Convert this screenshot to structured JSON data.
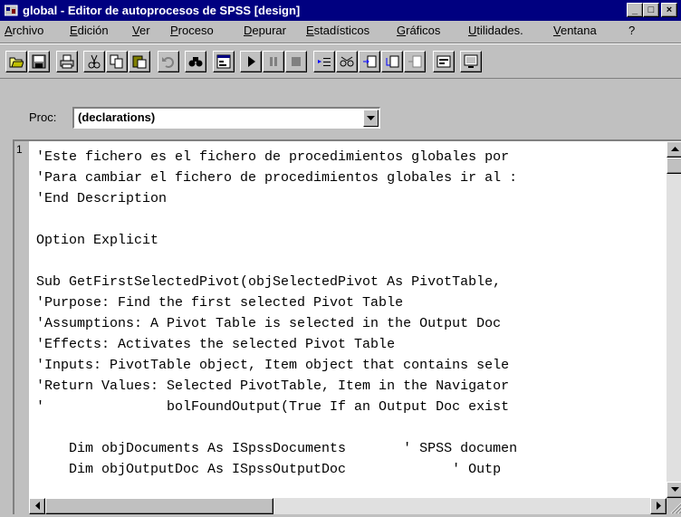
{
  "window": {
    "title": "global - Editor de autoprocesos de SPSS [design]",
    "minimize": "_",
    "maximize": "□",
    "close": "×"
  },
  "menu": {
    "items": [
      "Archivo",
      "Edición",
      "Ver",
      "Proceso",
      "Depurar",
      "Estadísticos",
      "Gráficos",
      "Utilidades.",
      "Ventana",
      "?"
    ]
  },
  "toolbar": {
    "buttons": [
      "open-icon",
      "save-icon",
      "print-icon",
      "cut-icon",
      "copy-icon",
      "paste-icon",
      "undo-icon",
      "find-icon",
      "dialog-icon",
      "run-icon",
      "pause-icon",
      "stop-icon",
      "step-icon",
      "watch-icon",
      "step-into-icon",
      "step-over-icon",
      "breakpoint-icon",
      "dialog-editor-icon",
      "screen-icon"
    ]
  },
  "proc": {
    "label": "Proc:",
    "value": "(declarations)"
  },
  "editor": {
    "line_number": "1",
    "lines": [
      "'Este fichero es el fichero de procedimientos globales por",
      "'Para cambiar el fichero de procedimientos globales ir al :",
      "'End Description",
      "",
      "Option Explicit",
      "",
      "Sub GetFirstSelectedPivot(objSelectedPivot As PivotTable,",
      "'Purpose: Find the first selected Pivot Table",
      "'Assumptions: A Pivot Table is selected in the Output Doc",
      "'Effects: Activates the selected Pivot Table",
      "'Inputs: PivotTable object, Item object that contains sele",
      "'Return Values: Selected PivotTable, Item in the Navigator",
      "'               bolFoundOutput(True If an Output Doc exist",
      "",
      "    Dim objDocuments As ISpssDocuments       ' SPSS documen",
      "    Dim objOutputDoc As ISpssOutputDoc             ' Outp"
    ]
  }
}
